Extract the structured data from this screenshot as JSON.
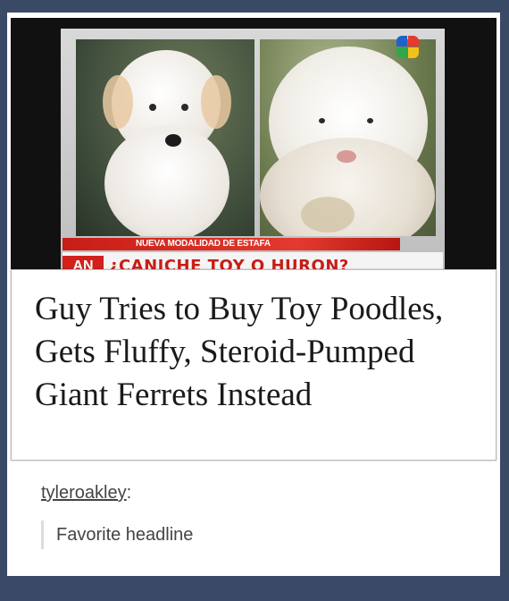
{
  "post": {
    "image": {
      "caption_strap": "NUEVA MODALIDAD DE ESTAFA",
      "channel_badge": "AN",
      "strap_headline": "¿CANICHE TOY O HURON?",
      "photo_left": "poodle",
      "photo_right": "ferret"
    },
    "headline": "Guy Tries to Buy Toy Poodles, Gets Fluffy, Steroid-Pumped Giant Ferrets Instead",
    "reblog": {
      "username": "tyleroakley",
      "separator": ":",
      "comment": "Favorite headline"
    }
  },
  "colors": {
    "background": "#3a4a66",
    "strap_red": "#c81d17"
  }
}
